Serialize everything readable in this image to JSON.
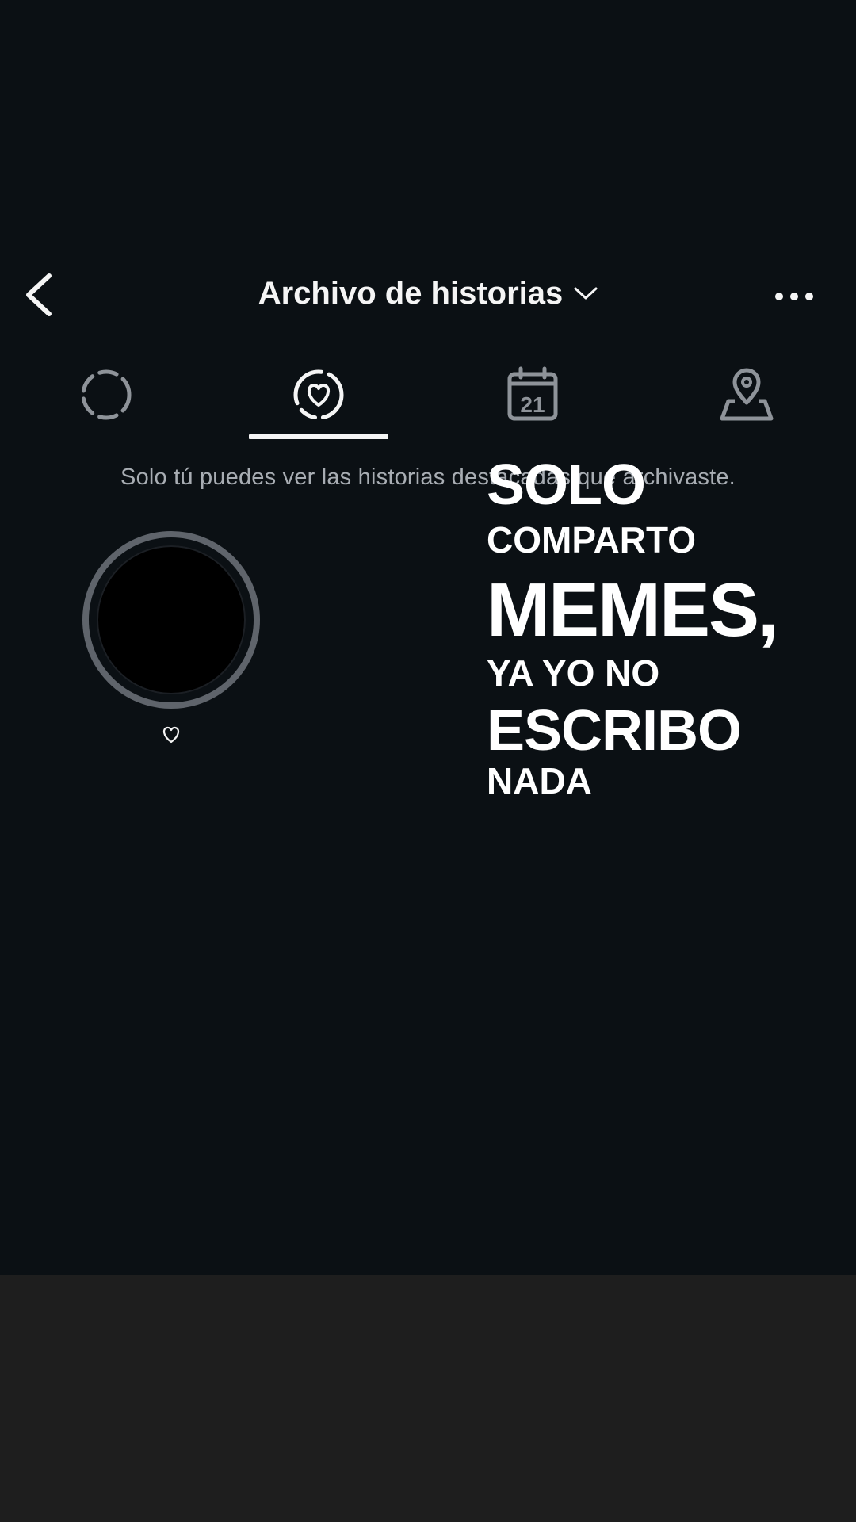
{
  "header": {
    "title": "Archivo de historias",
    "back_icon": "chevron-left-icon",
    "dropdown_icon": "chevron-down-icon",
    "more_icon": "more-horizontal-icon"
  },
  "tabs": [
    {
      "name": "stories",
      "icon": "dashed-circle-icon",
      "active": false
    },
    {
      "name": "highlights",
      "icon": "heart-circle-icon",
      "active": true
    },
    {
      "name": "calendar",
      "icon": "calendar-icon",
      "calendar_day": "21",
      "active": false
    },
    {
      "name": "map",
      "icon": "map-pin-icon",
      "active": false
    }
  ],
  "info_text": "Solo tú puedes ver las historias destacadas que archivaste.",
  "highlight": {
    "icon": "heart-outline-icon"
  },
  "overlay_text": {
    "line1": "SOLO",
    "line2": "COMPARTO",
    "line3": "MEMES,",
    "line4": "YA YO NO",
    "line5": "ESCRIBO",
    "line6": "NADA"
  },
  "colors": {
    "background": "#0b1014",
    "bottom_area": "#1e1e1e",
    "text_primary": "#f5f5f5",
    "text_secondary": "#a8adb3",
    "icon_inactive": "#8e9399",
    "ring": "#5f646b"
  }
}
